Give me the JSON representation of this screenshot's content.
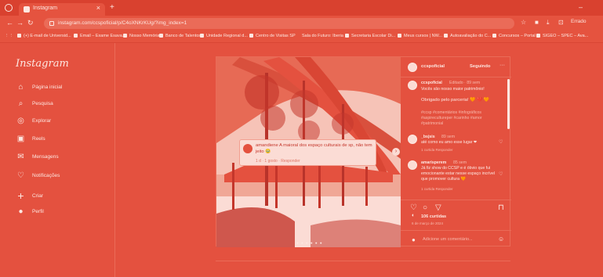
{
  "browser": {
    "tab_title": "Instagram",
    "tab_close": "×",
    "new_tab": "+",
    "minimize": "–",
    "url": "instagram.com/ccspoficial/p/C4oXNKrKUg/?img_index=1",
    "profile_label": "Errado"
  },
  "bookmarks": [
    "(+) E-mail de Universid...",
    "Email – Exame Esava...",
    "Nosso Memória",
    "Banco de Talentos",
    "Unidade Regional d...",
    "Centro de Visitas SP",
    "Sala do Futuro: Iberia",
    "Secretaria Escolar Di...",
    "Meus cursos | NW...",
    "Autoavaliação do C...",
    "Concursos – Portal",
    "SIGEO – SPEC – Ava..."
  ],
  "sidebar": {
    "logo": "Instagram",
    "items": [
      {
        "label": "Página inicial",
        "icon": "home-icon",
        "glyph": "⌂"
      },
      {
        "label": "Pesquisa",
        "icon": "search-icon",
        "glyph": "⌕"
      },
      {
        "label": "Explorar",
        "icon": "compass-icon",
        "glyph": "◎"
      },
      {
        "label": "Reels",
        "icon": "reels-icon",
        "glyph": "▣"
      },
      {
        "label": "Mensagens",
        "icon": "messenger-icon",
        "glyph": "✉"
      },
      {
        "label": "Notificações",
        "icon": "heart-icon",
        "glyph": "♡"
      },
      {
        "label": "Criar",
        "icon": "plus-icon",
        "glyph": "+"
      },
      {
        "label": "Perfil",
        "icon": "profile-icon",
        "glyph": "●"
      }
    ]
  },
  "post": {
    "username": "ccspoficial",
    "follow_status": "Seguindo",
    "more": "···",
    "caption_user": "ccspoficial",
    "caption_tag": "Editado · 89 sem",
    "caption_line1": "Vocês são nosso maior patrimônio!",
    "caption_line2": "Obrigado pelo parceria! 🧡 ❤️ 🧡",
    "hashtags": "#ccsp #comentários #infográficos #aspirecultureper #carinho #amor #patrimonial",
    "comments": [
      {
        "user": "_bsjsis",
        "time": "89 sem",
        "text": "até como eu amo esse lugar ❤",
        "meta": "1 curtida   Responder"
      },
      {
        "user": "amarisperem",
        "time": "85 sem",
        "text": "Já fiz show do CCSP e é óbvio que fui emocionante estar nesse espaço incrível que promover cultura 🧡",
        "meta": "1 curtida   Responder"
      }
    ],
    "overlay_user": "amandiene",
    "overlay_text": "amandiene A maioral dos espaço culturais de sp, não tem jeito 🥹",
    "overlay_meta": "1 d  ·  1 gosto  ·  Responder",
    "likes": "106 curtidas",
    "date": "6 de março de 2024",
    "add_comment_placeholder": "Adicione um comentário..."
  }
}
